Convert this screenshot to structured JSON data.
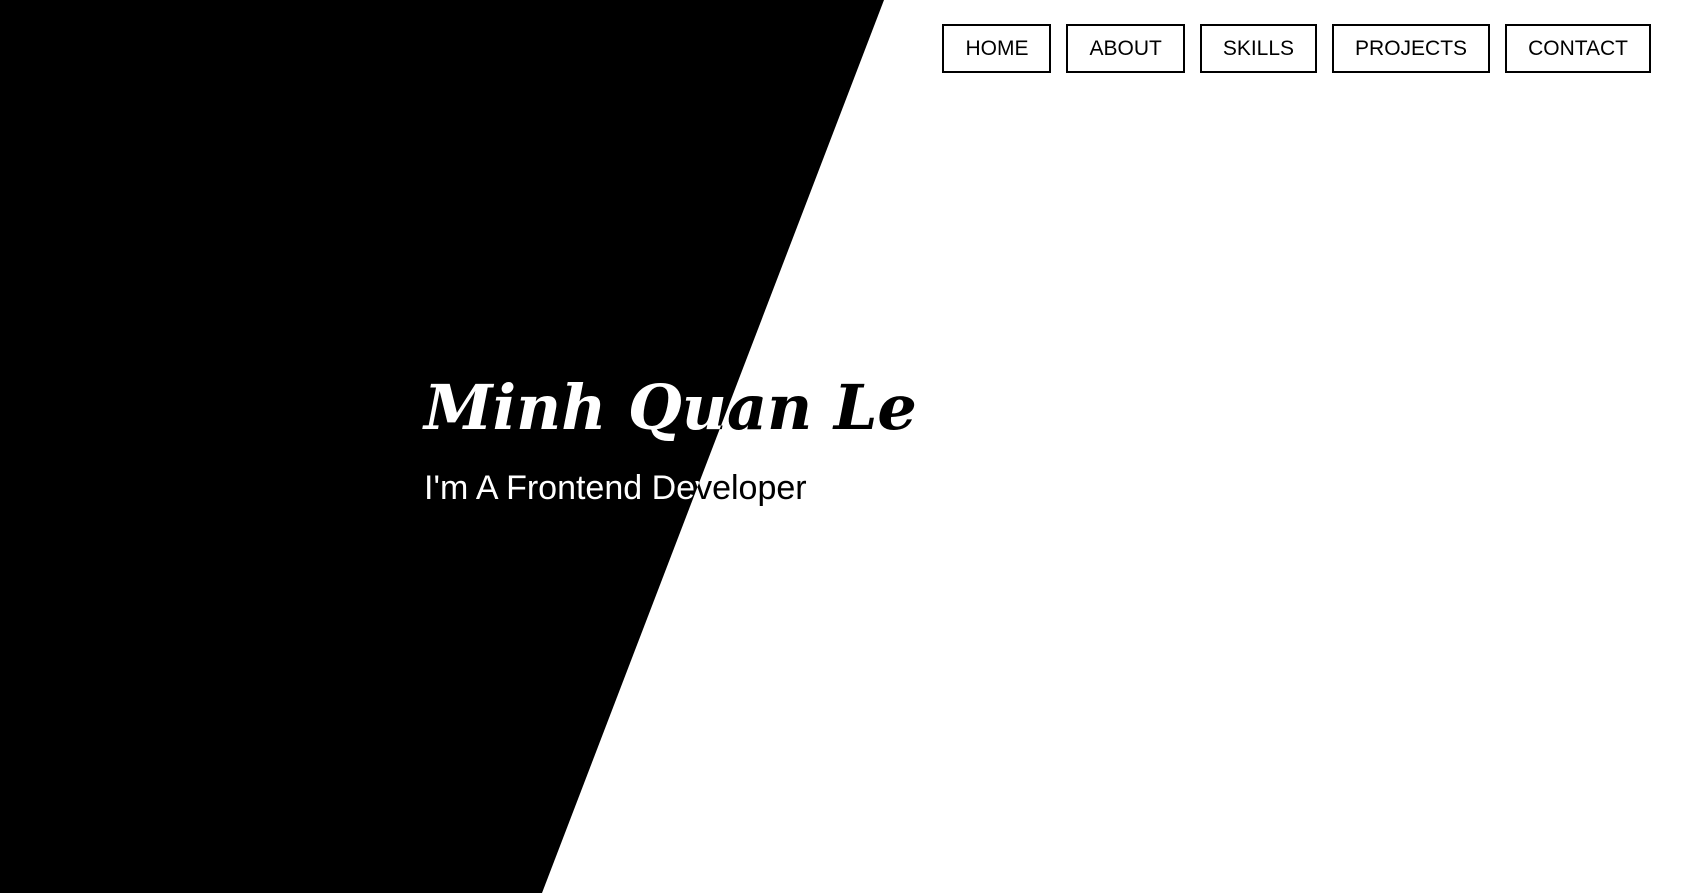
{
  "colors": {
    "panel": "#000000",
    "background": "#ffffff",
    "nav_border": "#000000",
    "nav_text": "#000000"
  },
  "nav": {
    "items": [
      {
        "label": "HOME"
      },
      {
        "label": "ABOUT"
      },
      {
        "label": "SKILLS"
      },
      {
        "label": "PROJECTS"
      },
      {
        "label": "CONTACT"
      }
    ]
  },
  "hero": {
    "name": "Minh Quan Le",
    "subtitle": "I'm A Frontend Developer"
  }
}
